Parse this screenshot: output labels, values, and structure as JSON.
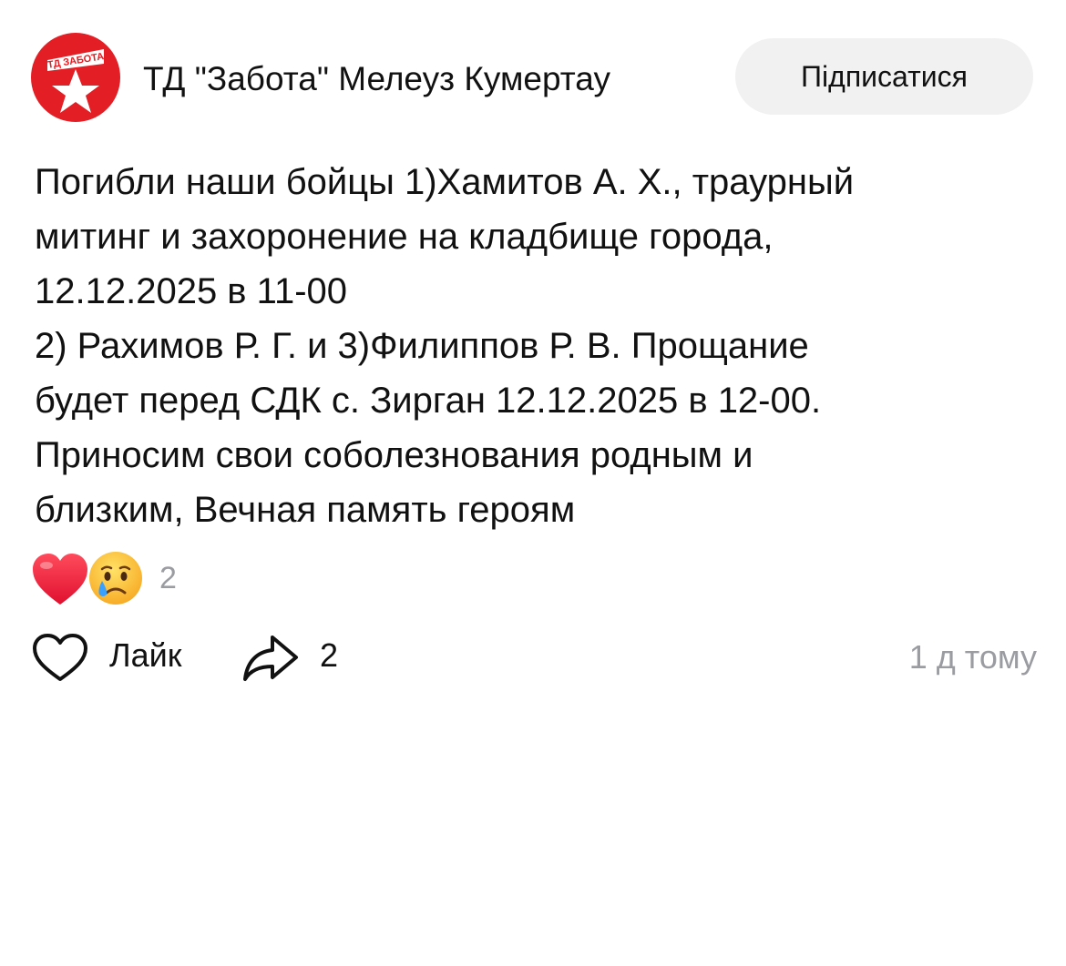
{
  "header": {
    "author_name": "ТД \"Забота\" Мелеуз Кумертау",
    "avatar_text": "ТД ЗАБОТА",
    "subscribe_label": "Підписатися"
  },
  "post": {
    "lines": [
      "Погибли наши бойцы 1)Хамитов А. Х., траурный",
      "митинг и захоронение на кладбище города,",
      "12.12.2025 в 11-00",
      "2) Рахимов Р. Г. и 3)Филиппов Р. В. Прощание",
      "будет перед СДК с. Зирган 12.12.2025 в 12-00.",
      "Приносим свои соболезнования родным и",
      "близким, Вечная память героям"
    ]
  },
  "reactions": {
    "emojis": [
      "heart-icon",
      "crying-face-icon"
    ],
    "count": "2"
  },
  "actions": {
    "like_label": "Лайк",
    "share_count": "2",
    "timestamp": "1 д тому"
  },
  "colors": {
    "brand_red": "#e31e24",
    "secondary_text": "#9a9ca1",
    "button_bg": "#f1f1f2"
  }
}
